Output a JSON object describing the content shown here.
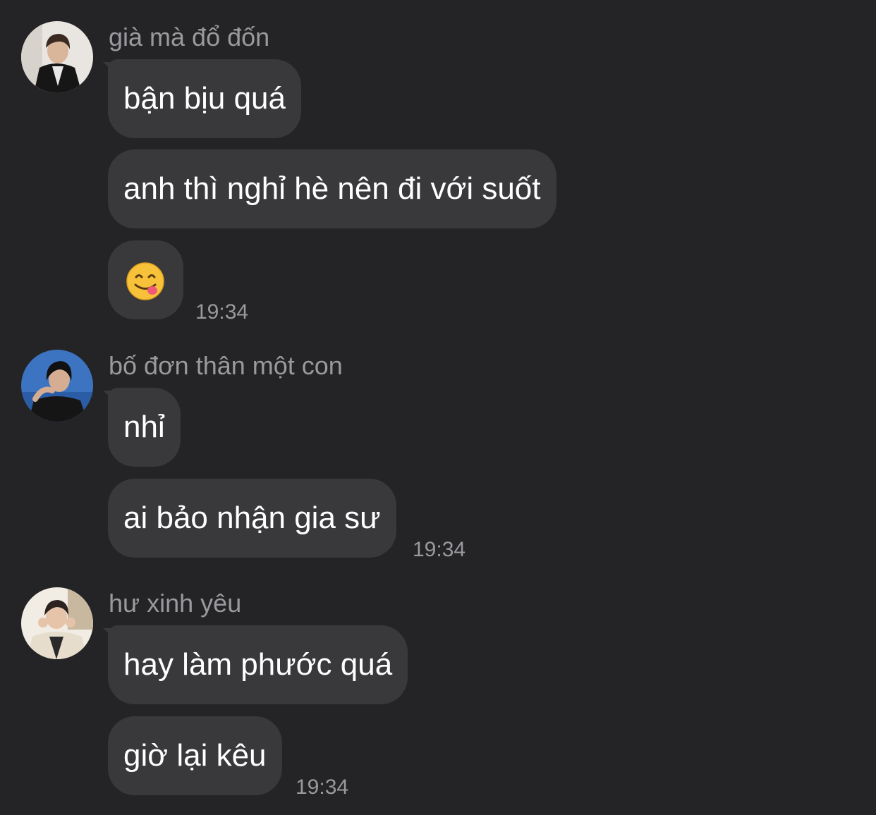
{
  "messages": [
    {
      "sender": "già mà đổ đốn",
      "avatar": "avatar-dark-jacket",
      "bubbles": [
        "bận bịu quá",
        "anh thì nghỉ hè nên đi với suốt"
      ],
      "emoji": "😋",
      "emoji_name": "face-savoring-food-emoji",
      "time": "19:34"
    },
    {
      "sender": "bố đơn thân một con",
      "avatar": "avatar-blue-background",
      "bubbles": [
        "nhỉ",
        "ai bảo nhận gia sư"
      ],
      "time": "19:34"
    },
    {
      "sender": "hư xinh yêu",
      "avatar": "avatar-light-jacket",
      "bubbles": [
        "hay làm phước quá",
        "giờ lại kêu"
      ],
      "time": "19:34"
    }
  ],
  "colors": {
    "background": "#242426",
    "bubble": "#39393c",
    "secondary_text": "#9a9a9e",
    "primary_text": "#ffffff"
  }
}
